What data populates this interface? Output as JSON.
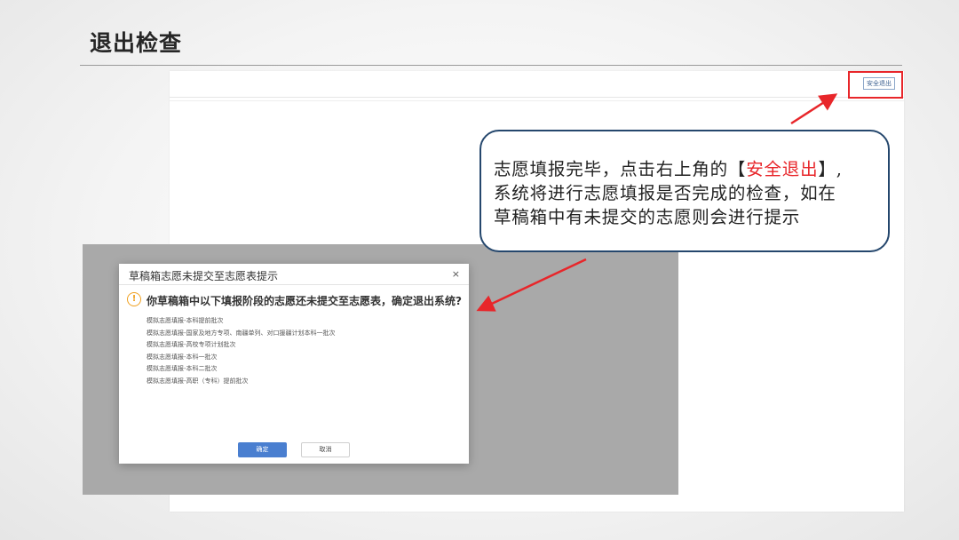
{
  "slide": {
    "title": "退出检查"
  },
  "screen": {
    "exit_button_label": "安全退出"
  },
  "callout": {
    "line1_prefix": "志愿填报完毕，点击右上角的【",
    "line1_highlight": "安全退出",
    "line1_suffix": "】,",
    "line2": "系统将进行志愿填报是否完成的检查，如在",
    "line3": "草稿箱中有未提交的志愿则会进行提示"
  },
  "dialog": {
    "title": "草稿箱志愿未提交至志愿表提示",
    "close_symbol": "×",
    "warning_symbol": "!",
    "question": "你草稿箱中以下填报阶段的志愿还未提交至志愿表，确定退出系统?",
    "batches": [
      "模拟志愿填报-本科提前批次",
      "模拟志愿填报-国家及地方专项、南疆单列、对口援疆计划本科一批次",
      "模拟志愿填报-高校专项计划批次",
      "模拟志愿填报-本科一批次",
      "模拟志愿填报-本科二批次",
      "模拟志愿填报-高职（专科）提前批次"
    ],
    "ok_label": "确定",
    "cancel_label": "取消"
  },
  "colors": {
    "accent_red": "#e8262a",
    "callout_border": "#25476d",
    "ok_button": "#4a7fd0",
    "warning": "#f0a020"
  }
}
